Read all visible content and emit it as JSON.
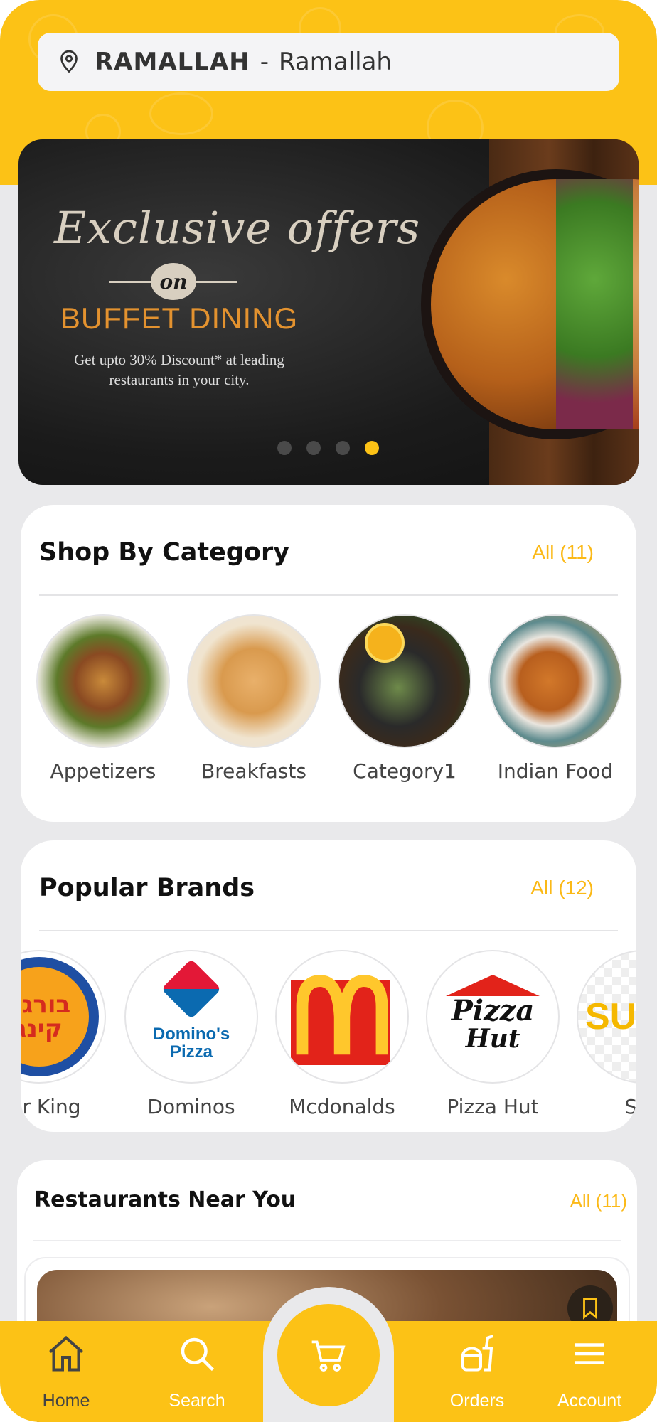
{
  "location": {
    "city": "RAMALLAH",
    "separator": "-",
    "area": "Ramallah"
  },
  "banner": {
    "script_title": "Exclusive offers",
    "on_text": "on",
    "title": "BUFFET DINING",
    "subtitle": "Get upto 30% Discount* at leading restaurants in your city.",
    "slides": 4,
    "active_slide": 4
  },
  "categories": {
    "title": "Shop By Category",
    "all_label": "All (11)",
    "items": [
      {
        "label": "Appetizers"
      },
      {
        "label": "Breakfasts"
      },
      {
        "label": "Category1"
      },
      {
        "label": "Indian Food"
      }
    ]
  },
  "brands": {
    "title": "Popular Brands",
    "all_label": "All (12)",
    "items": [
      {
        "label": "ger King"
      },
      {
        "label": "Dominos"
      },
      {
        "label": "Mcdonalds"
      },
      {
        "label": "Pizza Hut"
      },
      {
        "label": "Sub"
      }
    ],
    "logo_text": {
      "burger_king": "בורגר קינג",
      "dominos_line1": "Domino's",
      "dominos_line2": "Pizza",
      "pizza_hut_line1": "Pizza",
      "pizza_hut_line2": "Hut",
      "subway": "SUB"
    }
  },
  "restaurants": {
    "title": "Restaurants Near You",
    "all_label": "All (11)"
  },
  "nav": {
    "items": [
      {
        "label": "Home",
        "icon": "home-icon"
      },
      {
        "label": "Search",
        "icon": "search-icon"
      },
      {
        "label": "Orders",
        "icon": "orders-icon"
      },
      {
        "label": "Account",
        "icon": "menu-icon"
      }
    ],
    "center_icon": "cart-icon",
    "active": "Home"
  },
  "colors": {
    "accent": "#fcc216",
    "link": "#fbb917",
    "background": "#e9e9eb"
  }
}
